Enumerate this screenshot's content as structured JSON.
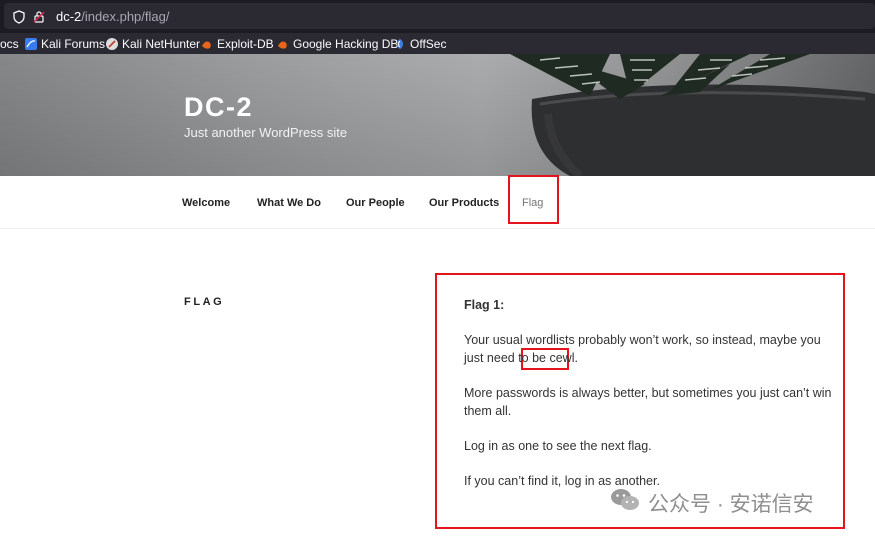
{
  "browser": {
    "url_host": "dc-2",
    "url_path": "/index.php/flag/",
    "bookmarks": [
      {
        "label": "ocs",
        "icon": "docs-icon"
      },
      {
        "label": "Kali Forums",
        "icon": "kali-icon"
      },
      {
        "label": "Kali NetHunter",
        "icon": "kali-nethunter-icon"
      },
      {
        "label": "Exploit-DB",
        "icon": "exploit-db-icon"
      },
      {
        "label": "Google Hacking DB",
        "icon": "ghdb-icon"
      },
      {
        "label": "OffSec",
        "icon": "offsec-icon"
      }
    ]
  },
  "site": {
    "title": "DC-2",
    "description": "Just another WordPress site"
  },
  "nav": {
    "items": [
      "Welcome",
      "What We Do",
      "Our People",
      "Our Products",
      "Flag"
    ],
    "active": "Flag"
  },
  "page": {
    "title": "FLAG",
    "heading": "Flag 1:",
    "p1_before": "Your usual wordlists probably won’t work, so instead, maybe you just need to be ",
    "p1_highlight": "cewl",
    "p1_after": ".",
    "p2": "More passwords is always better, but sometimes you just can’t win them all.",
    "p3": "Log in as one to see the next flag.",
    "p4": "If you can’t find it, log in as another."
  },
  "watermark": {
    "text": "公众号 · 安诺信安",
    "icon": "wechat-icon"
  },
  "colors": {
    "annotation_red": "#e3141c",
    "browser_dark": "#1c1b22",
    "toolbar": "#2b2a33"
  }
}
